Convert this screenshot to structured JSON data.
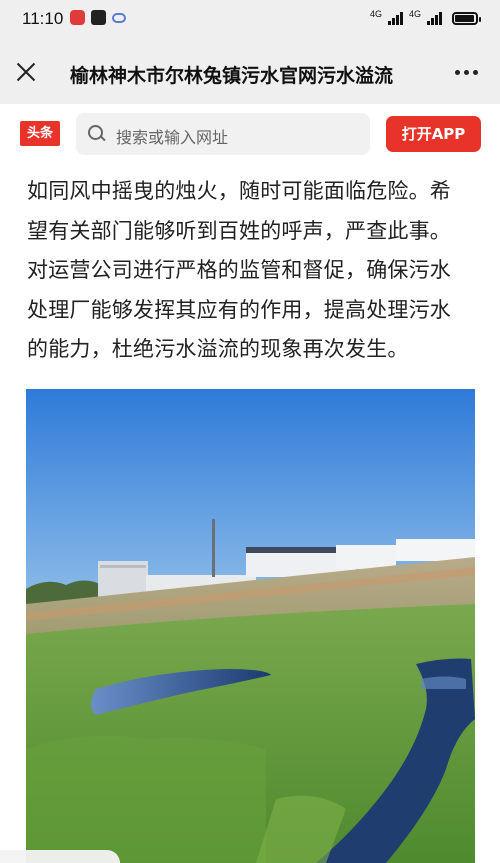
{
  "status_bar": {
    "time": "11:10",
    "network_1": "4G",
    "network_2": "4G",
    "battery_level": 0.85
  },
  "header": {
    "title": "榆林神木市尔林兔镇污水官网污水溢流"
  },
  "toolbar": {
    "logo_text": "头条",
    "search_placeholder": "搜索或输入网址",
    "open_app_label": "打开APP"
  },
  "article": {
    "lines": [
      "如同风中摇曳的烛火，随时可能面临危险。希",
      "望有关部门能够听到百姓的呼声，严查此事。",
      "对运营公司进行严格的监管和督促，确保污水",
      "处理厂能够发挥其应有的作用，提高处理污水",
      "的能力，杜绝污水溢流的现象再次发生。"
    ]
  },
  "colors": {
    "brand_red": "#e8332a",
    "chrome_gray": "#efefef",
    "sky_blue": "#3f86e0",
    "grass_green": "#5e9a3a",
    "water_blue": "#1a3a72"
  },
  "icons": [
    "close-icon",
    "more-icon",
    "search-icon",
    "signal-icon",
    "battery-icon"
  ]
}
